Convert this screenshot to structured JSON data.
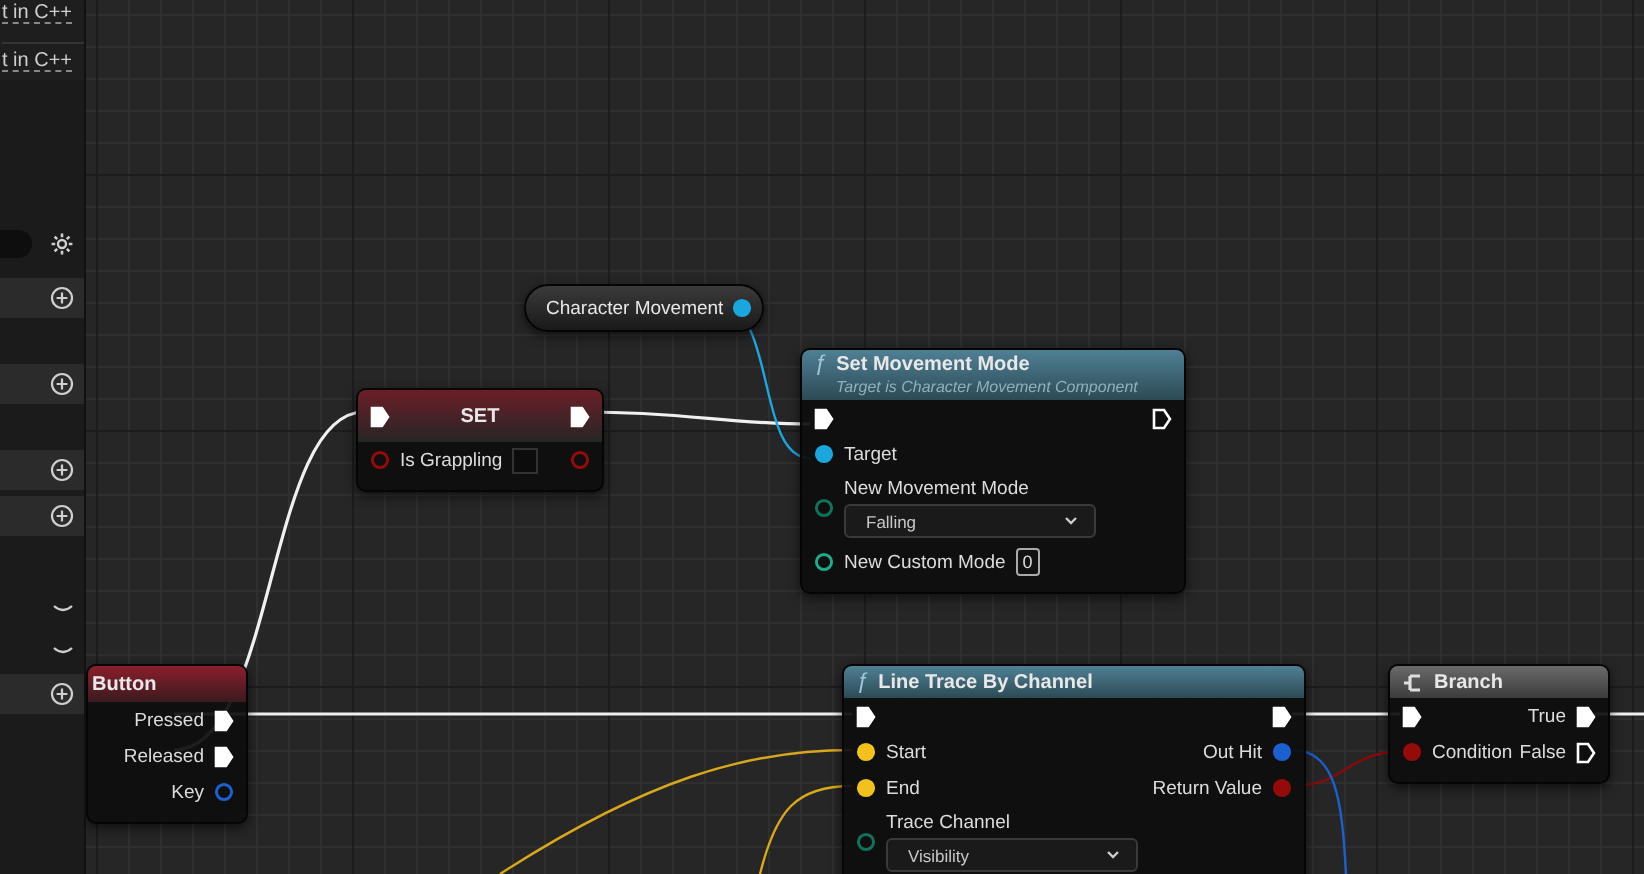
{
  "sidebar": {
    "links": [
      {
        "text": "t in C++"
      },
      {
        "text": "t in C++"
      }
    ],
    "rows": [
      {
        "kind": "search"
      },
      {
        "kind": "add"
      },
      {
        "kind": "add"
      },
      {
        "kind": "add"
      },
      {
        "kind": "add"
      },
      {
        "kind": "collapse"
      },
      {
        "kind": "collapse"
      },
      {
        "kind": "add"
      }
    ]
  },
  "nodes": [
    {
      "kind": "getter",
      "title": "Character Movement",
      "rows": [
        {
          "right": {
            "kind": "object",
            "connected": true
          }
        }
      ]
    },
    {
      "kind": "set",
      "title": "SET",
      "header_pins": {
        "left": {
          "kind": "exec",
          "connected": true
        },
        "right": {
          "kind": "exec",
          "connected": true
        }
      },
      "rows": [
        {
          "left": {
            "kind": "bool",
            "label": "Is Grappling",
            "connected": false,
            "checked": false
          },
          "right": {
            "kind": "bool",
            "connected": false
          }
        }
      ]
    },
    {
      "kind": "function",
      "glyph": "ƒ",
      "title": "Set Movement Mode",
      "subtitle": "Target is Character Movement Component",
      "rows": [
        {
          "left": {
            "kind": "exec",
            "connected": true
          },
          "right": {
            "kind": "exec",
            "connected": false
          }
        },
        {
          "left": {
            "kind": "object",
            "label": "Target",
            "connected": true
          }
        },
        {
          "left": {
            "kind": "enum",
            "label": "New Movement Mode",
            "connected": false,
            "value": "Falling"
          }
        },
        {
          "left": {
            "kind": "int",
            "label": "New Custom Mode",
            "connected": false,
            "value": "0"
          }
        }
      ]
    },
    {
      "kind": "event",
      "title": "Button",
      "rows": [
        {
          "right": {
            "kind": "exec",
            "label": "Pressed",
            "connected": true
          }
        },
        {
          "right": {
            "kind": "exec",
            "label": "Released",
            "connected": true
          }
        },
        {
          "right": {
            "kind": "struct",
            "label": "Key",
            "connected": false
          }
        }
      ]
    },
    {
      "kind": "function",
      "glyph": "ƒ",
      "title": "Line Trace By Channel",
      "rows": [
        {
          "left": {
            "kind": "exec",
            "connected": true
          },
          "right": {
            "kind": "exec",
            "connected": true
          }
        },
        {
          "left": {
            "kind": "vector",
            "label": "Start",
            "connected": true
          },
          "right": {
            "kind": "struct",
            "label": "Out Hit",
            "connected": true
          }
        },
        {
          "left": {
            "kind": "vector",
            "label": "End",
            "connected": true
          },
          "right": {
            "kind": "bool",
            "label": "Return Value",
            "connected": true
          }
        },
        {
          "left": {
            "kind": "enum",
            "label": "Trace Channel",
            "connected": false,
            "value": "Visibility"
          }
        }
      ]
    },
    {
      "kind": "branch",
      "title": "Branch",
      "rows": [
        {
          "left": {
            "kind": "exec",
            "connected": true
          },
          "right": {
            "kind": "exec",
            "label": "True",
            "connected": true
          }
        },
        {
          "left": {
            "kind": "bool",
            "label": "Condition",
            "connected": true
          },
          "right": {
            "kind": "exec",
            "label": "False",
            "connected": false
          }
        }
      ]
    }
  ]
}
